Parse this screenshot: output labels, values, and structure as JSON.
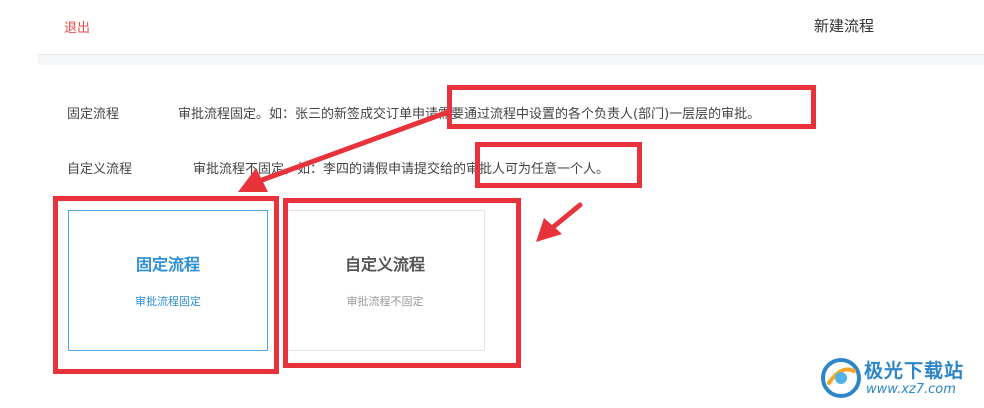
{
  "header": {
    "logout_label": "退出",
    "title": "新建流程"
  },
  "flow_types": [
    {
      "name": "固定流程",
      "description": "审批流程固定。如：张三的新签成交订单申请需要通过流程中设置的各个负责人(部门)一层层的审批。"
    },
    {
      "name": "自定义流程",
      "description": "审批流程不固定，如：李四的请假申请提交给的审批人可为任意一个人。"
    }
  ],
  "cards": [
    {
      "title": "固定流程",
      "subtitle": "审批流程固定",
      "selected": true
    },
    {
      "title": "自定义流程",
      "subtitle": "审批流程不固定",
      "selected": false
    }
  ],
  "annotation_color": "#e8333c",
  "watermark": {
    "text": "极光下载站",
    "url": "www.xz7.com"
  }
}
